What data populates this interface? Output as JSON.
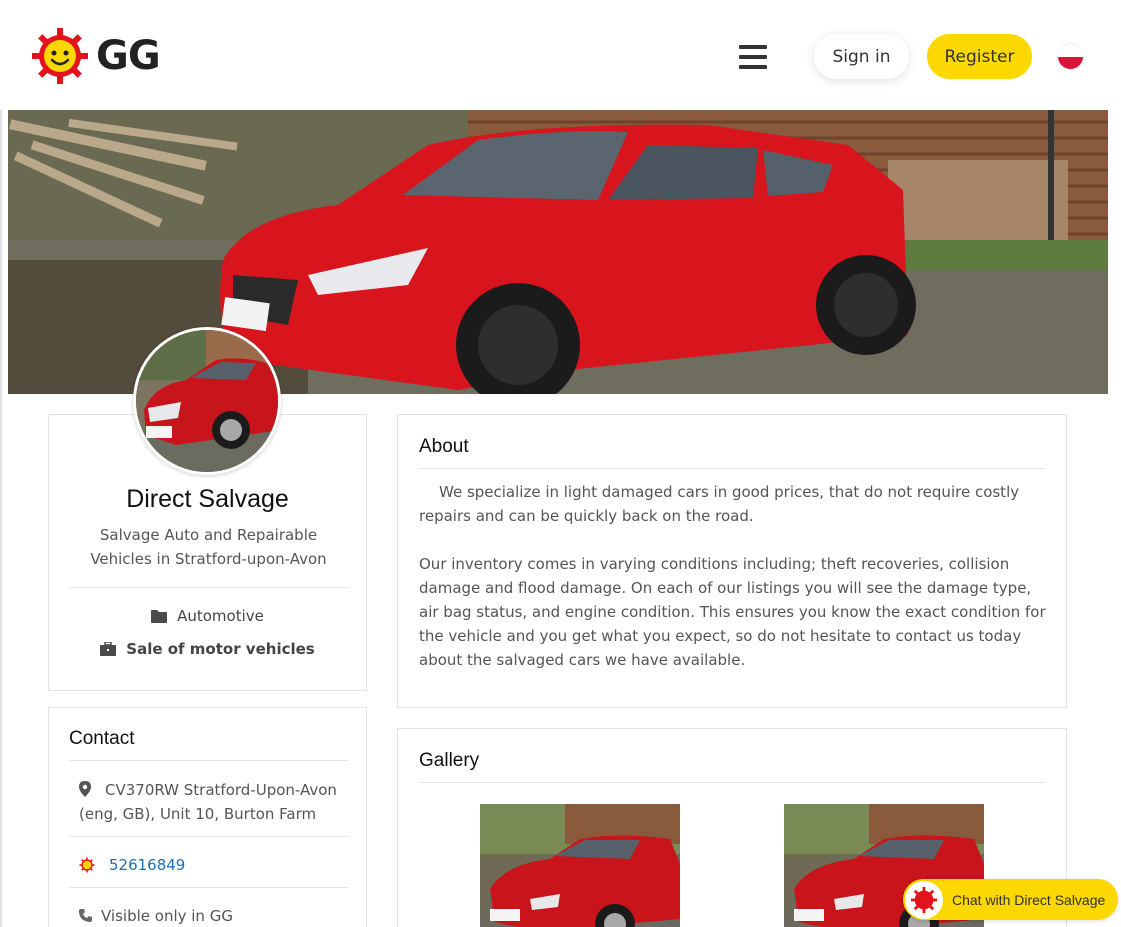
{
  "header": {
    "logo_text": "GG",
    "signin_label": "Sign in",
    "register_label": "Register",
    "language_flag": "pl-flag-icon"
  },
  "profile": {
    "name": "Direct Salvage",
    "subtitle": "Salvage Auto and Repairable Vehicles in Stratford-upon-Avon",
    "category": "Automotive",
    "subcategory": "Sale of motor vehicles"
  },
  "contact": {
    "title": "Contact",
    "address": "CV370RW Stratford-Upon-Avon (eng, GB), Unit 10, Burton Farm",
    "gg_number": "52616849",
    "phone": "Visible only in GG"
  },
  "about": {
    "title": "About",
    "paragraphs": [
      "We specialize in light damaged cars in good prices, that do not require costly repairs and can be quickly back on the road.",
      "Our inventory comes in varying conditions including; theft recoveries, collision damage and flood damage. On each of our listings you will see the damage type, air bag status, and engine condition. This ensures you know the exact condition for the vehicle and you get what you expect, so do not hesitate to contact us today about the salvaged cars we have available."
    ]
  },
  "gallery": {
    "title": "Gallery"
  },
  "chat": {
    "label": "Chat with Direct Salvage"
  },
  "colors": {
    "brand_yellow": "#fcd700",
    "brand_red": "#e3131b",
    "link_blue": "#1b6fb5",
    "car_red": "#d8141c"
  }
}
